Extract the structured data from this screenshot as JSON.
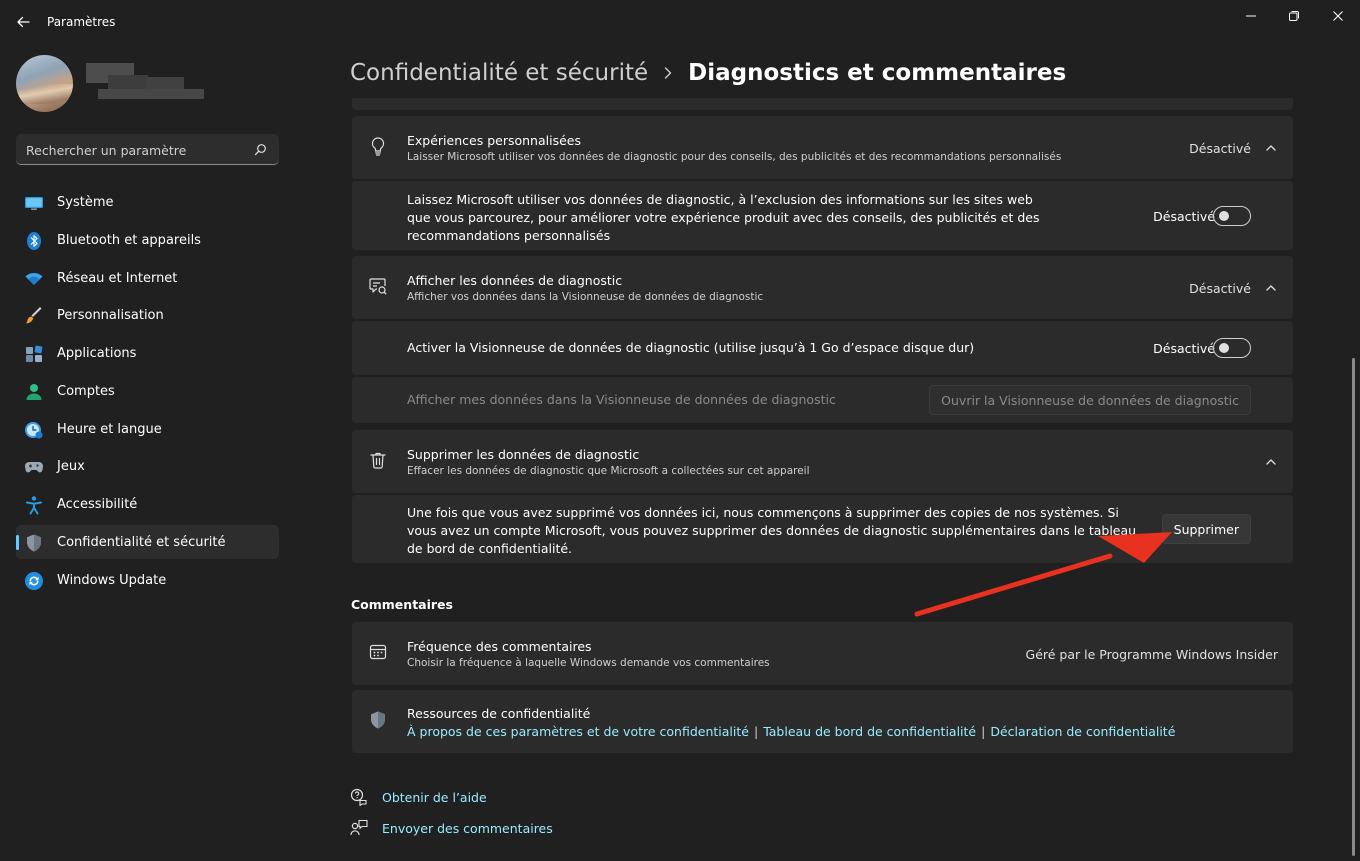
{
  "window": {
    "title": "Paramètres"
  },
  "sidebar": {
    "search_placeholder": "Rechercher un paramètre",
    "items": [
      {
        "label": "Système",
        "icon": "monitor-icon"
      },
      {
        "label": "Bluetooth et appareils",
        "icon": "bluetooth-icon"
      },
      {
        "label": "Réseau et Internet",
        "icon": "wifi-icon"
      },
      {
        "label": "Personnalisation",
        "icon": "brush-icon"
      },
      {
        "label": "Applications",
        "icon": "apps-icon"
      },
      {
        "label": "Comptes",
        "icon": "person-icon"
      },
      {
        "label": "Heure et langue",
        "icon": "clock-globe-icon"
      },
      {
        "label": "Jeux",
        "icon": "gamepad-icon"
      },
      {
        "label": "Accessibilité",
        "icon": "accessibility-icon"
      },
      {
        "label": "Confidentialité et sécurité",
        "icon": "shield-icon",
        "active": true
      },
      {
        "label": "Windows Update",
        "icon": "update-icon"
      }
    ]
  },
  "breadcrumb": {
    "parent": "Confidentialité et sécurité",
    "current": "Diagnostics et commentaires"
  },
  "cards": {
    "experiences": {
      "title": "Expériences personnalisées",
      "desc": "Laisser Microsoft utiliser vos données de diagnostic pour des conseils, des publicités et des recommandations personnalisés",
      "status": "Désactivé",
      "sub_text": "Laissez Microsoft utiliser vos données de diagnostic, à l’exclusion des informations sur les sites web que vous parcourez, pour améliorer votre expérience produit avec des conseils, des publicités et des recommandations personnalisés",
      "toggle_label": "Désactivé"
    },
    "viewer": {
      "title": "Afficher les données de diagnostic",
      "desc": "Afficher vos données dans la Visionneuse de données de diagnostic",
      "status": "Désactivé",
      "sub1_text": "Activer la Visionneuse de données de diagnostic (utilise jusqu’à 1 Go d’espace disque dur)",
      "sub1_toggle_label": "Désactivé",
      "sub2_text": "Afficher mes données dans la Visionneuse de données de diagnostic",
      "sub2_button": "Ouvrir la Visionneuse de données de diagnostic"
    },
    "delete": {
      "title": "Supprimer les données de diagnostic",
      "desc": "Effacer les données de diagnostic que Microsoft a collectées sur cet appareil",
      "sub_text": "Une fois que vous avez supprimé vos données ici, nous commençons à supprimer des copies de nos systèmes. Si vous avez un compte Microsoft, vous pouvez supprimer des données de diagnostic supplémentaires dans le tableau de bord de confidentialité.",
      "button": "Supprimer"
    }
  },
  "comments_section": {
    "heading": "Commentaires",
    "frequency": {
      "title": "Fréquence des commentaires",
      "desc": "Choisir la fréquence à laquelle Windows demande vos commentaires",
      "status": "Géré par le Programme Windows Insider"
    },
    "resources": {
      "title": "Ressources de confidentialité",
      "links": [
        "À propos de ces paramètres et de votre confidentialité",
        "Tableau de bord de confidentialité",
        "Déclaration de confidentialité"
      ]
    }
  },
  "help_links": {
    "get_help": "Obtenir de l’aide",
    "send_feedback": "Envoyer des commentaires"
  },
  "colors": {
    "accent": "#60cdff",
    "link": "#99ebff",
    "annotation_arrow": "#e8321f"
  }
}
